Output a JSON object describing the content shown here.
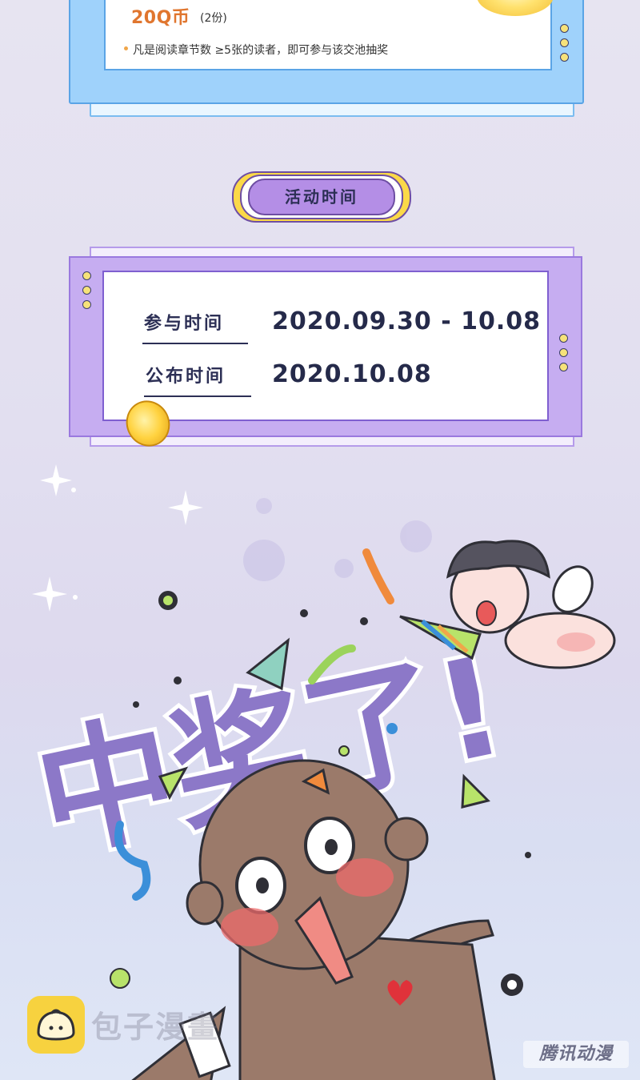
{
  "prize": {
    "amount": "20Q币",
    "count": "(2份)",
    "note": "凡是阅读章节数 ≥5张的读者，即可参与该交池抽奖"
  },
  "section_title": "活动时间",
  "schedule": {
    "participate_label": "参与时间",
    "participate_value": "2020.09.30 - 10.08",
    "announce_label": "公布时间",
    "announce_value": "2020.10.08"
  },
  "illustration": {
    "text": "中奖了!"
  },
  "watermark": {
    "brand_text": "包子漫畫",
    "publisher_text": "腾讯动漫"
  },
  "colors": {
    "prize_accent": "#e0762f",
    "title_pill": "#b48ee6",
    "card_purple": "#c6adf1",
    "card_blue": "#9fd2fb",
    "headline_purple": "#8c78c8"
  }
}
